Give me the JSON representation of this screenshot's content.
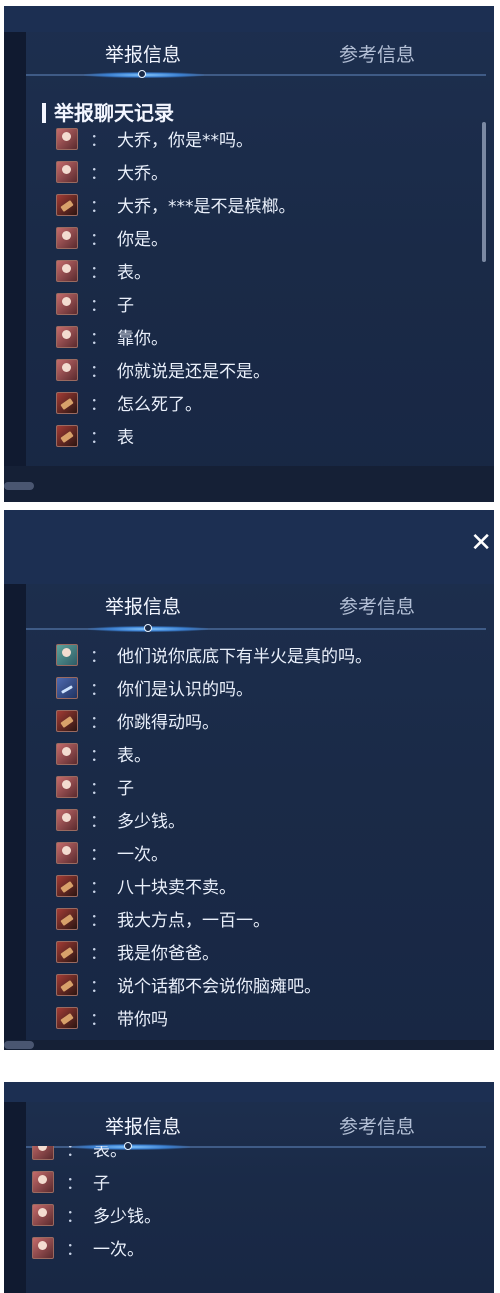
{
  "panel1": {
    "tab_report": "举报信息",
    "tab_reference": "参考信息",
    "section_title": "举报聊天记录",
    "messages": [
      {
        "avatar": "a",
        "text": "大乔，你是**吗。"
      },
      {
        "avatar": "a",
        "text": "大乔。"
      },
      {
        "avatar": "b",
        "text": "大乔，***是不是槟榔。"
      },
      {
        "avatar": "a",
        "text": "你是。"
      },
      {
        "avatar": "a",
        "text": "表。"
      },
      {
        "avatar": "a",
        "text": "子"
      },
      {
        "avatar": "a",
        "text": "靠你。"
      },
      {
        "avatar": "a",
        "text": "你就说是还是不是。"
      },
      {
        "avatar": "b",
        "text": "怎么死了。"
      },
      {
        "avatar": "b",
        "text": "表"
      }
    ]
  },
  "panel2": {
    "close_icon": "✕",
    "tab_report": "举报信息",
    "tab_reference": "参考信息",
    "messages": [
      {
        "avatar": "c",
        "text": "他们说你底底下有半火是真的吗。"
      },
      {
        "avatar": "d",
        "text": "你们是认识的吗。"
      },
      {
        "avatar": "b",
        "text": "你跳得动吗。"
      },
      {
        "avatar": "a",
        "text": "表。"
      },
      {
        "avatar": "a",
        "text": "子"
      },
      {
        "avatar": "a",
        "text": "多少钱。"
      },
      {
        "avatar": "a",
        "text": "一次。"
      },
      {
        "avatar": "b",
        "text": "八十块卖不卖。"
      },
      {
        "avatar": "b",
        "text": "我大方点，一百一。"
      },
      {
        "avatar": "b",
        "text": "我是你爸爸。"
      },
      {
        "avatar": "b",
        "text": "说个话都不会说你脑瘫吧。"
      },
      {
        "avatar": "b",
        "text": "带你吗"
      }
    ]
  },
  "panel3": {
    "tab_report": "举报信息",
    "tab_reference": "参考信息",
    "messages": [
      {
        "avatar": "a",
        "text": "表。"
      },
      {
        "avatar": "a",
        "text": "子"
      },
      {
        "avatar": "a",
        "text": "多少钱。"
      },
      {
        "avatar": "a",
        "text": "一次。"
      }
    ]
  },
  "colors": {
    "panel_bg": "#1a2a47",
    "tab_active": "#f2f6ff",
    "tab_inactive": "#b4c0d6",
    "accent_glow": "#86c9ff"
  }
}
